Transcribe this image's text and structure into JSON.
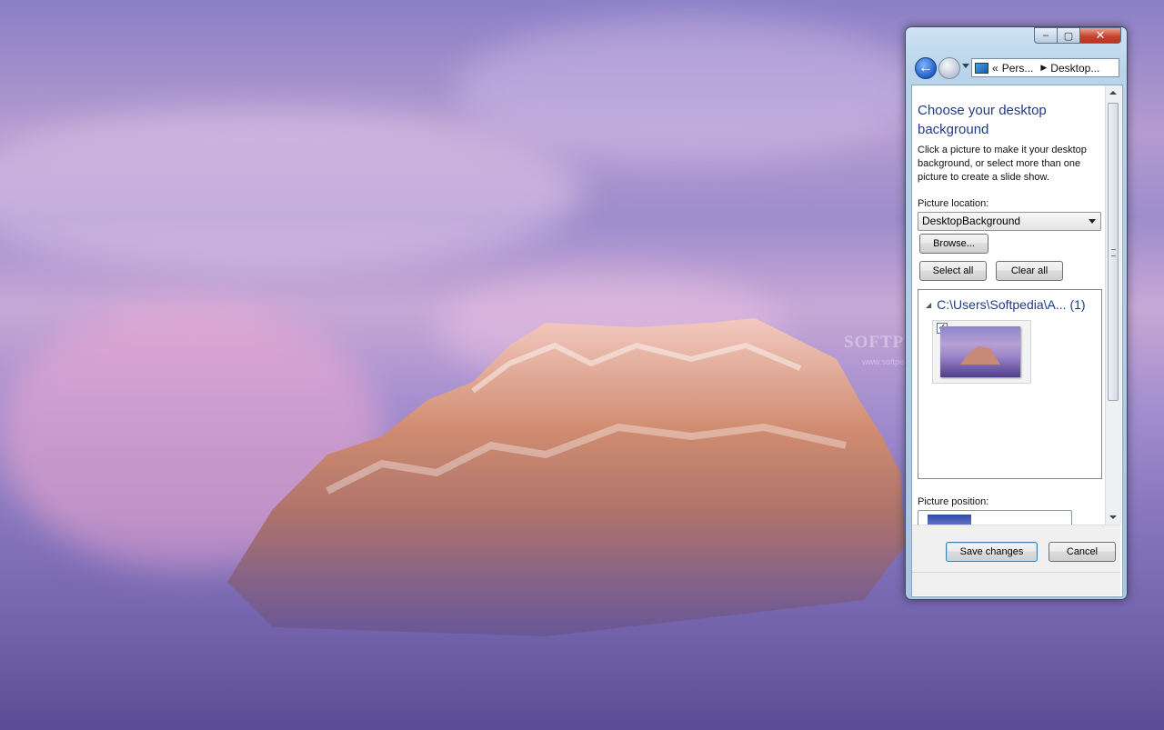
{
  "watermark": {
    "brand": "SOFTPEDIA",
    "url": "www.softpedia.com"
  },
  "window": {
    "caption": {
      "minimize": "‒",
      "maximize": "▢",
      "close": "✕"
    },
    "nav": {
      "address_prefix": "«",
      "crumbs": [
        "Pers...",
        "Desktop..."
      ],
      "separator": "▶"
    },
    "heading": "Choose your desktop background",
    "description": "Click a picture to make it your desktop background, or select more than one picture to create a slide show.",
    "picture_location": {
      "label": "Picture location:",
      "selected": "DesktopBackground"
    },
    "buttons": {
      "browse": "Browse...",
      "select_all": "Select all",
      "clear_all": "Clear all",
      "save": "Save changes",
      "cancel": "Cancel"
    },
    "gallery": {
      "group_label": "C:\\Users\\Softpedia\\A... (1)",
      "items": [
        {
          "checked": true,
          "check_mark": "✓"
        }
      ]
    },
    "picture_position": {
      "label": "Picture position:"
    }
  }
}
